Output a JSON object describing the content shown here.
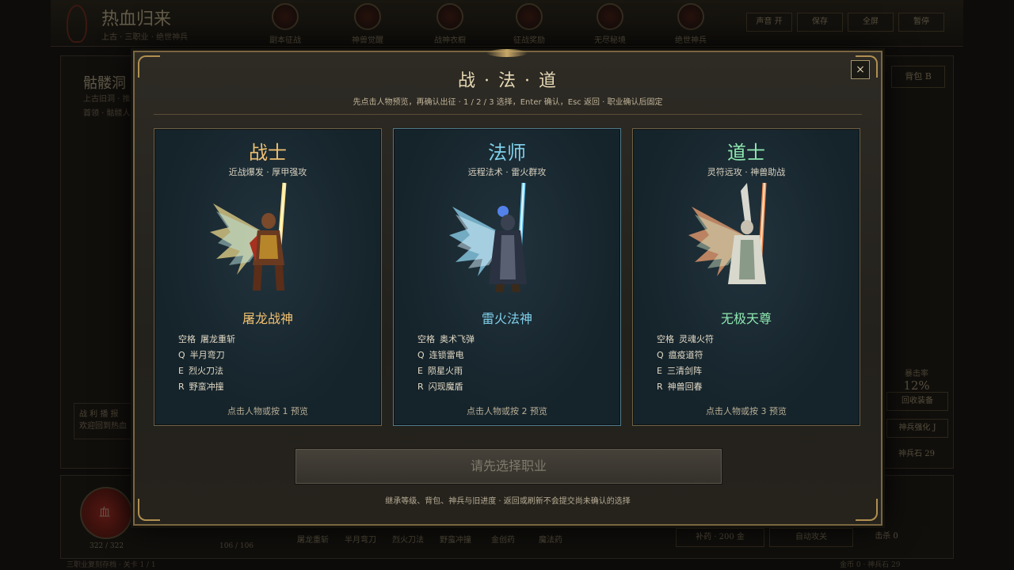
{
  "hud": {
    "game_title": "热血归来",
    "game_subtitle": "上古 · 三职业 · 绝世神兵",
    "top_nav": [
      "副本征战",
      "神兽觉醒",
      "战神衣橱",
      "征战奖励",
      "无尽秘境",
      "绝世神兵"
    ],
    "top_buttons": [
      "声音 开",
      "保存",
      "全屏",
      "暂停"
    ],
    "dungeon_name": "骷髅洞",
    "dungeon_lines": [
      "上古旧洞 · 推",
      "首领 · 骷髅人王"
    ],
    "battle_log_title": "战 利 播 报",
    "battle_log_text": "欢迎回到热血",
    "bag_button": "背包 B",
    "right_buttons": [
      "回收装备",
      "神兵强化 J"
    ],
    "rate_label": "暴击率",
    "rate_value": "12%",
    "shard_text": "神兵石 29",
    "hp_label": "血",
    "hp_value": "322 / 322",
    "mp_value": "106 / 106",
    "skills_bar": [
      "屠龙重斩",
      "半月弯刀",
      "烈火刀法",
      "野蛮冲撞",
      "金创药",
      "魔法药"
    ],
    "pills": [
      "补药 · 200 金",
      "自动攻关"
    ],
    "auto_note": "击杀 0",
    "footer_left": "三职业复刻存档 · 关卡 1 / 1",
    "footer_right": "金币 0 · 神兵石 29"
  },
  "modal": {
    "title": "战 · 法 · 道",
    "hint": "先点击人物预览，再确认出征 · 1 / 2 / 3 选择，Enter 确认，Esc 返回 · 职业确认后固定",
    "close_label": "×",
    "confirm_label": "请先选择职业",
    "footer": "继承等级、背包、神兵与旧进度 · 返回或刷新不会提交尚未确认的选择",
    "classes": [
      {
        "name": "战士",
        "tagline": "近战爆发 · 厚甲强攻",
        "hero_title": "屠龙战神",
        "skills": [
          [
            "空格",
            "屠龙重斩"
          ],
          [
            "Q",
            "半月弯刀"
          ],
          [
            "E",
            "烈火刀法"
          ],
          [
            "R",
            "野蛮冲撞"
          ]
        ],
        "footer": "点击人物或按 1 预览",
        "name_color": "#f0c070",
        "wing_color": "#e8d68a"
      },
      {
        "name": "法师",
        "tagline": "远程法术 · 雷火群攻",
        "hero_title": "雷火法神",
        "skills": [
          [
            "空格",
            "奥术飞弹"
          ],
          [
            "Q",
            "连锁雷电"
          ],
          [
            "E",
            "陨星火雨"
          ],
          [
            "R",
            "闪现魔盾"
          ]
        ],
        "footer": "点击人物或按 2 预览",
        "name_color": "#7fd0ea",
        "wing_color": "#8fd6f2"
      },
      {
        "name": "道士",
        "tagline": "灵符远攻 · 神兽助战",
        "hero_title": "无极天尊",
        "skills": [
          [
            "空格",
            "灵魂火符"
          ],
          [
            "Q",
            "瘟疫道符"
          ],
          [
            "E",
            "三清剑阵"
          ],
          [
            "R",
            "神兽回春"
          ]
        ],
        "footer": "点击人物或按 3 预览",
        "name_color": "#8ee8b0",
        "wing_color": "#f0a070"
      }
    ]
  }
}
